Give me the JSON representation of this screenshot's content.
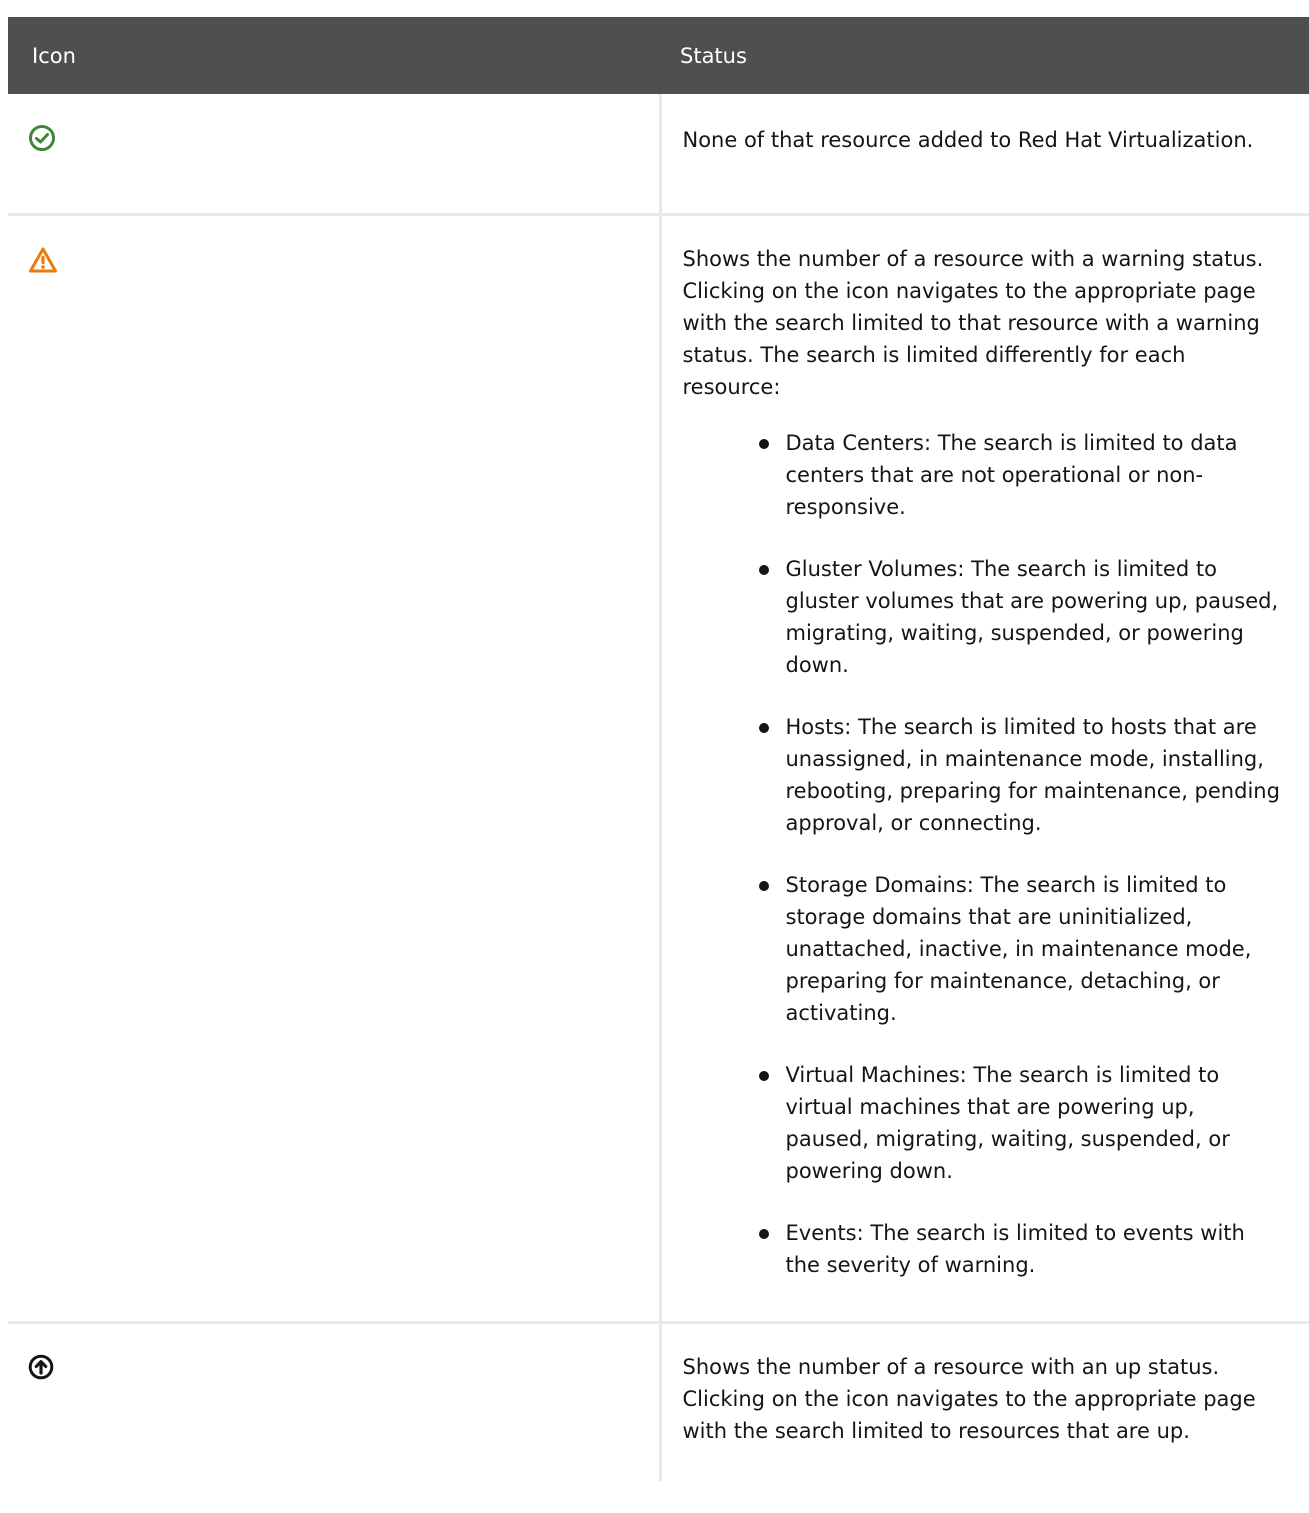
{
  "table": {
    "headers": [
      "Icon",
      "Status"
    ],
    "rows": [
      {
        "icon": "check-circle-icon",
        "icon_color": "#3e8635",
        "text": "None of that resource added to Red Hat Virtualization."
      },
      {
        "icon": "warning-triangle-icon",
        "icon_color": "#ec7a08",
        "text": "Shows the number of a resource with a warning status. Clicking on the icon navigates to the appropriate page with the search limited to that resource with a warning status. The search is limited differently for each resource:",
        "items": [
          {
            "term": "Data Centers",
            "desc": ": The search is limited to data centers that are not operational or non-responsive."
          },
          {
            "term": "Gluster Volumes",
            "desc": ": The search is limited to gluster volumes that are powering up, paused, migrating, waiting, suspended, or powering down."
          },
          {
            "term": "Hosts",
            "desc": ": The search is limited to hosts that are unassigned, in maintenance mode, installing, rebooting, preparing for maintenance, pending approval, or connecting."
          },
          {
            "term": "Storage Domains",
            "desc": ": The search is limited to storage domains that are uninitialized, unattached, inactive, in maintenance mode, preparing for maintenance, detaching, or activating."
          },
          {
            "term": "Virtual Machines",
            "desc": ": The search is limited to virtual machines that are powering up, paused, migrating, waiting, suspended, or powering down."
          },
          {
            "term": "Events",
            "desc": ": The search is limited to events with the severity of warning."
          }
        ]
      },
      {
        "icon": "arrow-up-circle-icon",
        "icon_color": "#151515",
        "text": "Shows the number of a resource with an up status. Clicking on the icon navigates to the appropriate page with the search limited to resources that are up."
      }
    ]
  }
}
